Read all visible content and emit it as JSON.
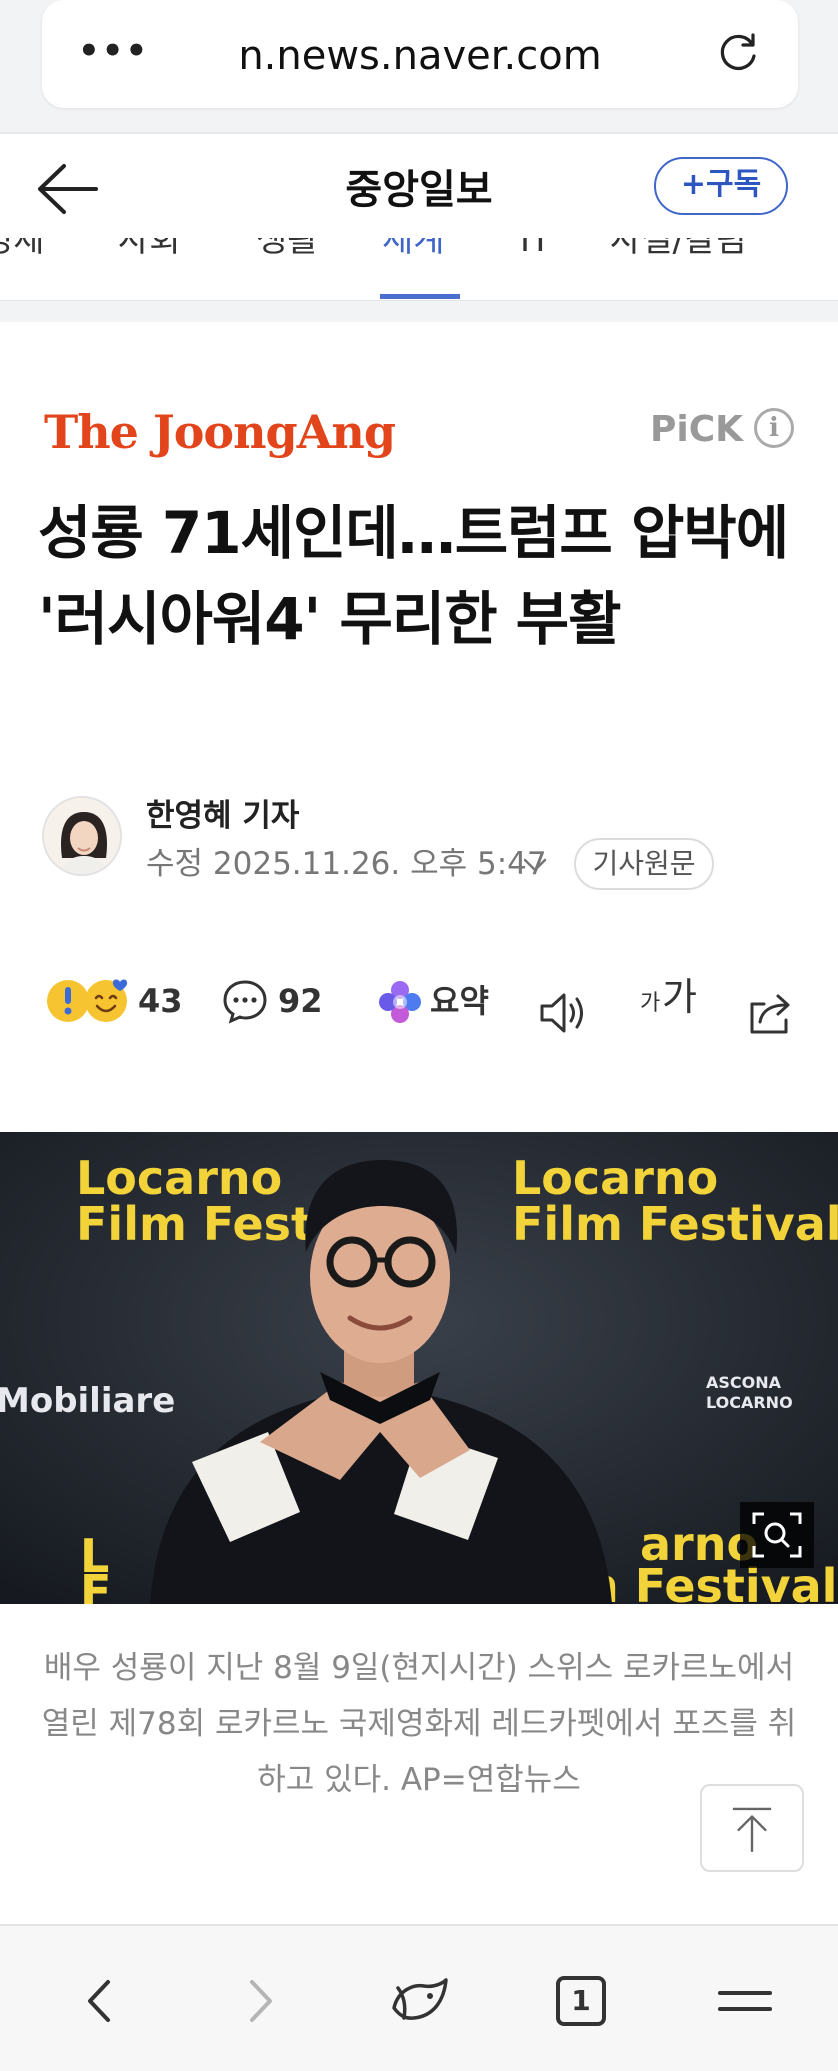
{
  "browser": {
    "menu_label": "•••",
    "url": "n.news.naver.com"
  },
  "header": {
    "press_name": "중앙일보",
    "subscribe_label": "+구독"
  },
  "categories": [
    "경제",
    "사회",
    "생활",
    "세계",
    "IT",
    "사설/칼럼"
  ],
  "article": {
    "brand_logo": "The JoongAng",
    "pick_label": "PiCK",
    "pick_info_icon": "i",
    "headline": "성룡 71세인데…트럼프 압박에 '러시아워4' 무리한 부활",
    "reporter": "한영혜 기자",
    "edit_time": "수정 2025.11.26. 오후 5:47",
    "original_link_label": "기사원문",
    "reactions_count": "43",
    "comments_count": "92",
    "summary_label": "요약",
    "font_size_label_small": "가",
    "font_size_label_large": "가",
    "photo_caption": "배우 성룡이 지난 8월 9일(현지시간) 스위스 로카르노에서 열린 제78회 로카르노 국제영화제 레드카펫에서 포즈를 취하고 있다. AP=연합뉴스"
  },
  "photo": {
    "backdrop_text_1": "Locarno",
    "backdrop_text_2": "Film Festival",
    "backdrop_text_left_1": "Locarno",
    "backdrop_text_left_2": "Film Fest",
    "sponsor_left": "Mobiliare",
    "sponsor_right_1": "ASCONA",
    "sponsor_right_2": "LOCARNO",
    "bottom_text_1": "arno",
    "bottom_text_2": "n Festival"
  },
  "bottom_nav": {
    "tab_count": "1"
  },
  "colors": {
    "accent_blue": "#3f66c8",
    "brand_orange": "#e2451b",
    "festival_yellow": "#f2d43a"
  },
  "icons": [
    "dots-menu-icon",
    "reload-icon",
    "back-arrow-icon",
    "info-icon",
    "reaction-emoji-icon",
    "comment-icon",
    "ai-summary-icon",
    "speaker-icon",
    "font-size-icon",
    "share-icon",
    "zoom-search-icon",
    "scroll-top-icon",
    "nav-back-icon",
    "nav-forward-icon",
    "home-logo-icon",
    "tabs-icon",
    "menu-icon"
  ]
}
